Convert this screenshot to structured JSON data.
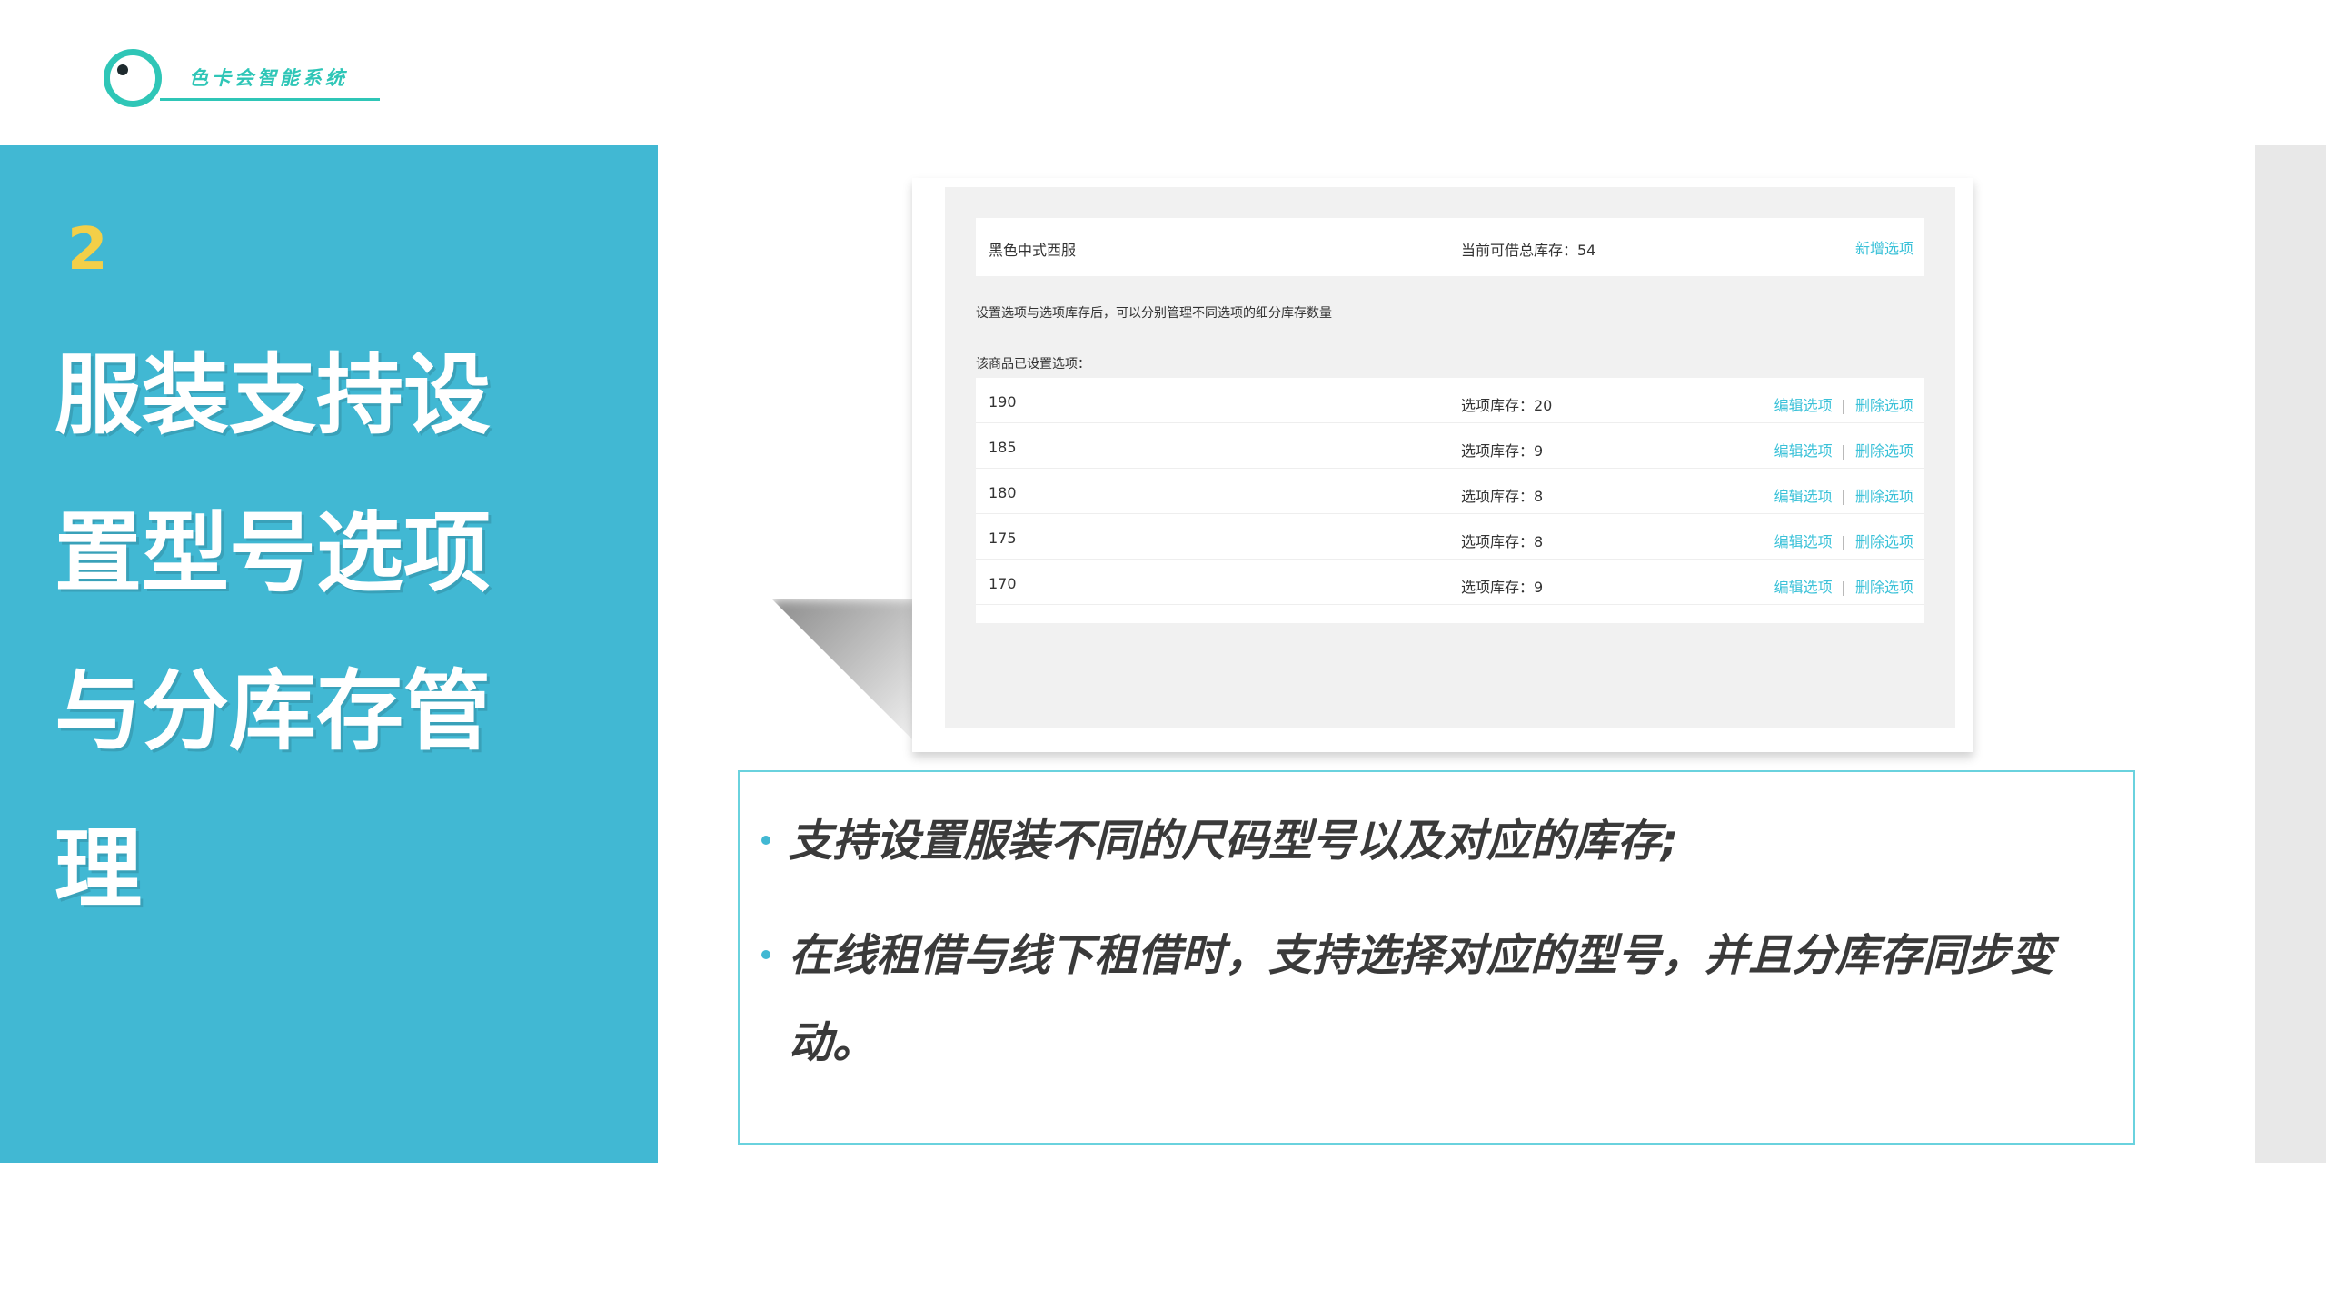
{
  "brand": {
    "name": "色卡会智能系统"
  },
  "section": {
    "number": "2",
    "title": "服装支持设置型号选项与分库存管理"
  },
  "screenshot": {
    "product_name": "黑色中式西服",
    "total_label": "当前可借总库存：54",
    "add_link": "新增选项",
    "note": "设置选项与选项库存后，可以分别管理不同选项的细分库存数量",
    "sub_title": "该商品已设置选项：",
    "rows": [
      {
        "size": "190",
        "stock": "选项库存：20",
        "edit": "编辑选项",
        "sep": "|",
        "delete": "删除选项"
      },
      {
        "size": "185",
        "stock": "选项库存：9",
        "edit": "编辑选项",
        "sep": "|",
        "delete": "删除选项"
      },
      {
        "size": "180",
        "stock": "选项库存：8",
        "edit": "编辑选项",
        "sep": "|",
        "delete": "删除选项"
      },
      {
        "size": "175",
        "stock": "选项库存：8",
        "edit": "编辑选项",
        "sep": "|",
        "delete": "删除选项"
      },
      {
        "size": "170",
        "stock": "选项库存：9",
        "edit": "编辑选项",
        "sep": "|",
        "delete": "删除选项"
      }
    ]
  },
  "bullets": [
    "支持设置服装不同的尺码型号以及对应的库存;",
    "在线租借与线下租借时，支持选择对应的型号，并且分库存同步变动。"
  ],
  "colors": {
    "panel": "#41b8d3",
    "accent": "#2fc6b7",
    "number": "#f3cf48",
    "link": "#3ac1d8"
  }
}
